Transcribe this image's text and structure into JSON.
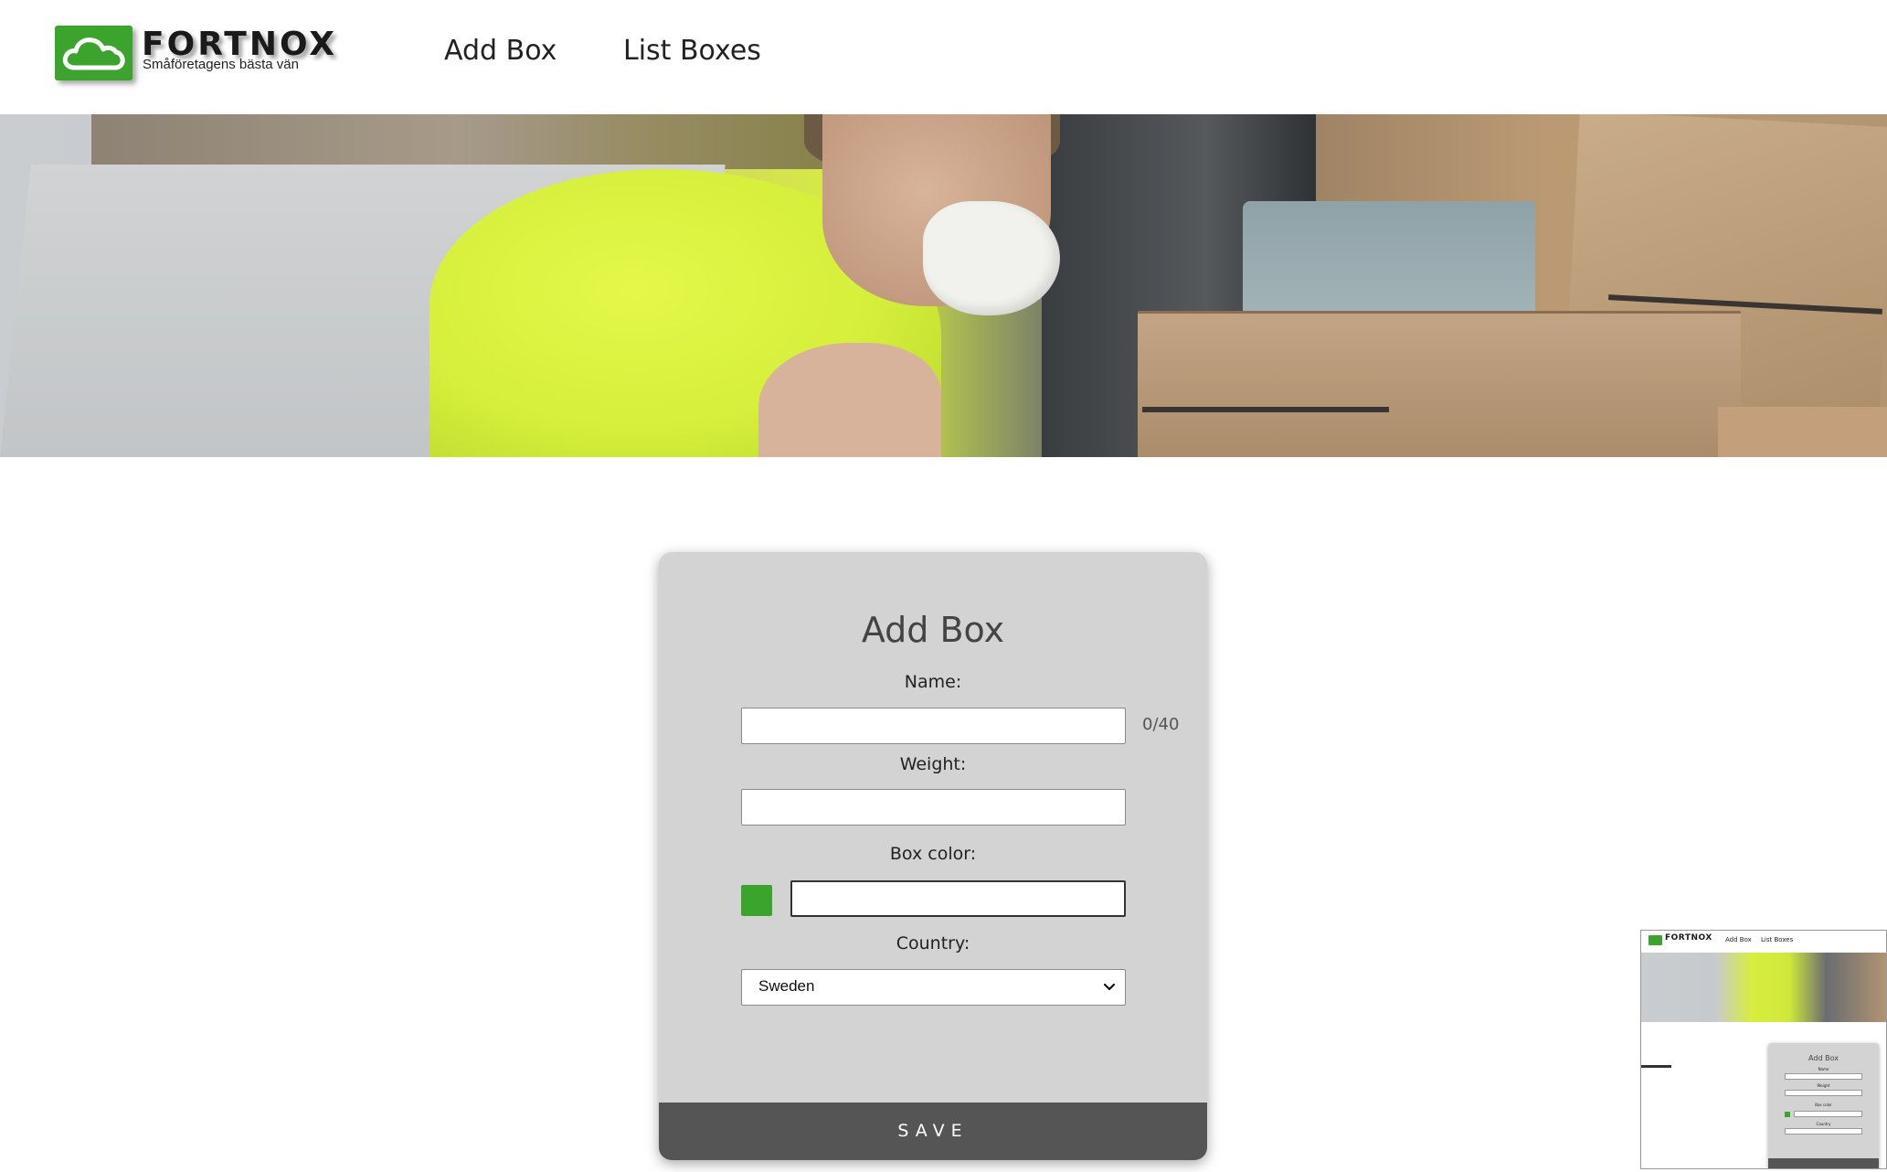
{
  "header": {
    "logo_word": "FORTNOX",
    "logo_tagline": "Småföretagens bästa vän",
    "nav": [
      {
        "label": "Add Box"
      },
      {
        "label": "List Boxes"
      }
    ]
  },
  "hero": {
    "icon": "warehouse-photo"
  },
  "form": {
    "title": "Add Box",
    "name_label": "Name:",
    "name_value": "",
    "name_counter": "0/40",
    "weight_label": "Weight:",
    "weight_value": "",
    "color_label": "Box color:",
    "color_value": "",
    "color_swatch": "#3aa42c",
    "country_label": "Country:",
    "country_selected": "Sweden",
    "save_label": "SAVE"
  },
  "thumbnail": {
    "logo_word": "FORTNOX",
    "nav": [
      "Add Box",
      "List Boxes"
    ],
    "title": "Add Box",
    "name_label": "Name",
    "weight_label": "Weight",
    "color_label": "Box color",
    "country_label": "Country",
    "country_selected": "Sweden"
  },
  "colors": {
    "brand_green": "#3aa42c",
    "card_bg": "#d3d3d3",
    "save_bg": "#555555"
  }
}
